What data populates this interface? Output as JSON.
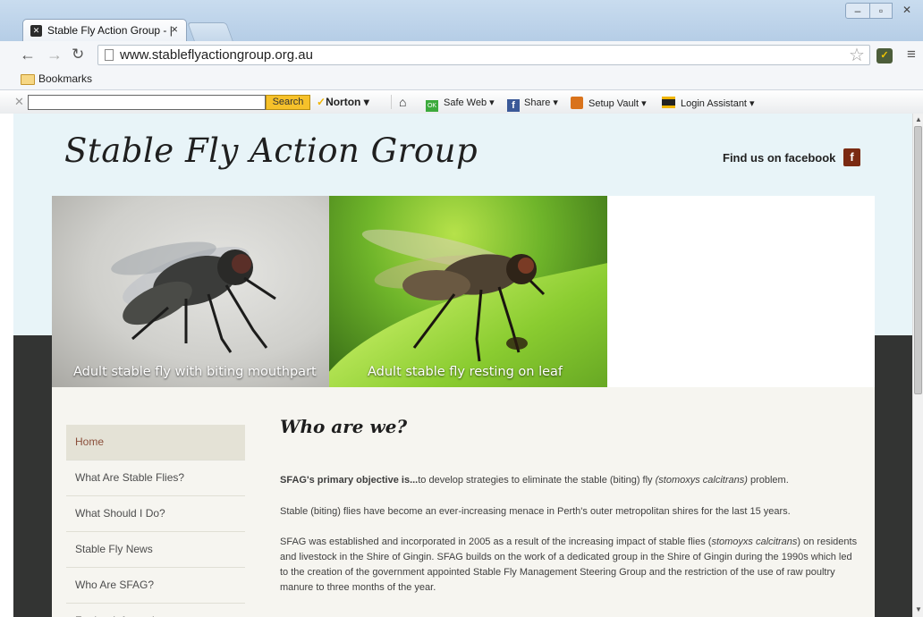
{
  "browser": {
    "tab_title": "Stable Fly Action Group - |",
    "tab_close": "×",
    "url": "www.stableflyactiongroup.org.au",
    "bookmarks_label": "Bookmarks",
    "window": {
      "minimize": "–",
      "maximize": "▫",
      "close": "✕"
    }
  },
  "norton_toolbar": {
    "search_button": "Search",
    "norton_label": "Norton",
    "safe_web": "Safe Web",
    "share": "Share",
    "setup_vault": "Setup Vault",
    "login_assistant": "Login Assistant"
  },
  "site": {
    "logo": "Stable Fly Action Group",
    "facebook_link": "Find us on facebook",
    "facebook_badge": "f",
    "banner_captions": [
      "Adult stable fly with biting mouthpart",
      "Adult stable fly resting on leaf"
    ],
    "nav": [
      "Home",
      "What Are Stable Flies?",
      "What Should I Do?",
      "Stable Fly News",
      "Who Are SFAG?",
      "Further Information"
    ],
    "heading": "Who are we?",
    "paragraphs": {
      "p1_bold": "SFAG's primary objective is...",
      "p1_text": "to develop strategies to eliminate the stable (biting) fly ",
      "p1_em": "(stomoxys calcitrans)",
      "p1_end": " problem.",
      "p2": "Stable (biting) flies have become an ever-increasing menace in Perth's outer metropolitan shires for the last 15 years.",
      "p3_a": "SFAG was established and incorporated in 2005 as a result of the increasing impact of stable flies (",
      "p3_em": "stomoyxs calcitrans",
      "p3_b": ") on residents and livestock in the Shire of Gingin. SFAG builds on the work of a dedicated group in the Shire of Gingin during the 1990s which led to the creation of the government appointed Stable Fly Management Steering Group and the restriction of the use of raw poultry manure to three months of the year."
    }
  }
}
